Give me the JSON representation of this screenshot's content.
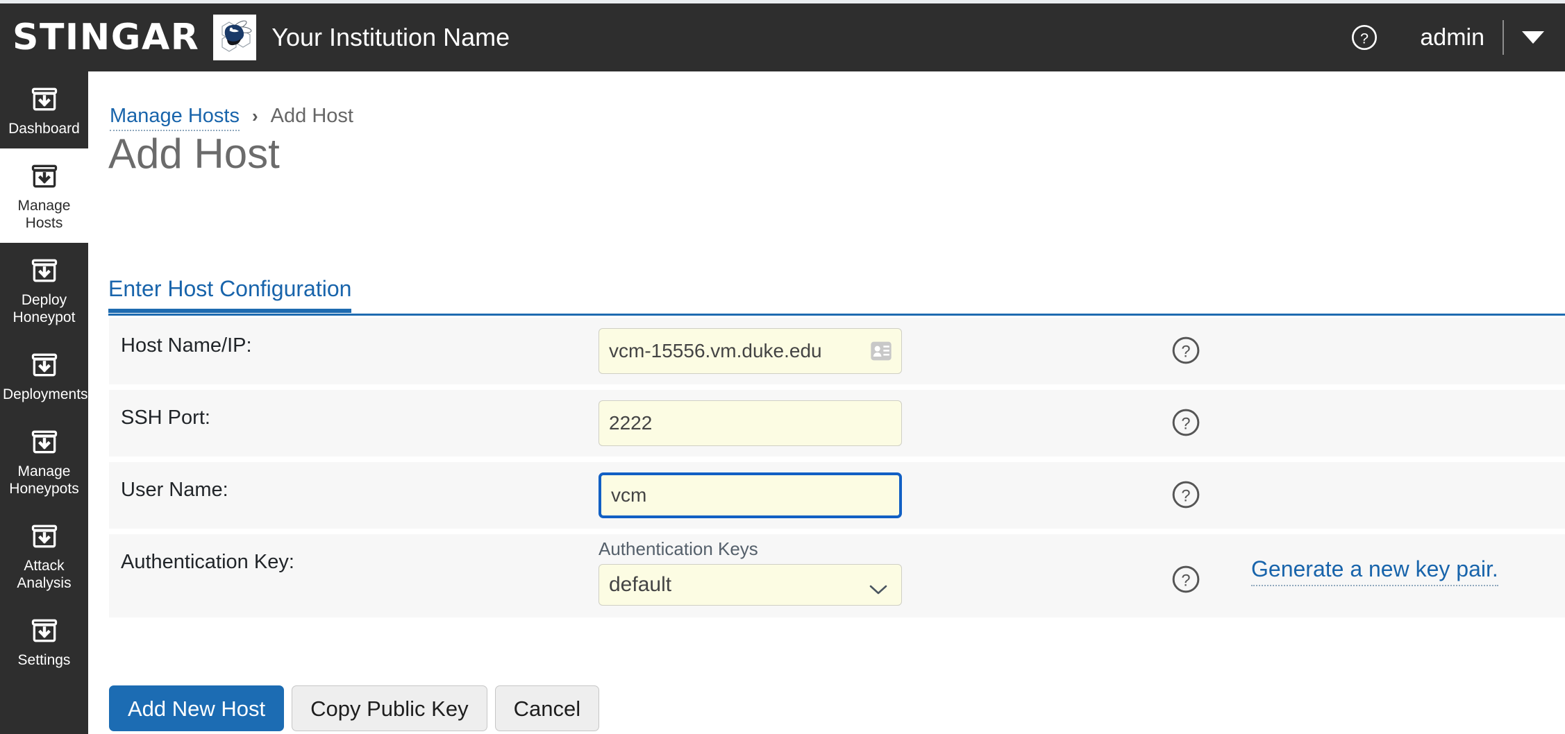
{
  "header": {
    "wordmark": "STINGAR",
    "logo_icon": "bee-honeycomb-logo",
    "institution": "Your Institution Name",
    "help_icon": "help-circle-icon",
    "username": "admin",
    "caret_icon": "caret-down-icon"
  },
  "sidebar": {
    "items": [
      {
        "label": "Dashboard",
        "icon": "archive-download-icon",
        "active": false
      },
      {
        "label": "Manage Hosts",
        "icon": "archive-download-icon",
        "active": true
      },
      {
        "label": "Deploy Honeypot",
        "icon": "archive-download-icon",
        "active": false
      },
      {
        "label": "Deployments",
        "icon": "archive-download-icon",
        "active": false
      },
      {
        "label": "Manage Honeypots",
        "icon": "archive-download-icon",
        "active": false
      },
      {
        "label": "Attack Analysis",
        "icon": "archive-download-icon",
        "active": false
      },
      {
        "label": "Settings",
        "icon": "archive-download-icon",
        "active": false
      }
    ]
  },
  "breadcrumb": {
    "parent": "Manage Hosts",
    "separator": "›",
    "current": "Add Host"
  },
  "page": {
    "title": "Add Host",
    "tab_label": "Enter Host Configuration"
  },
  "form": {
    "rows": [
      {
        "label": "Host Name/IP:",
        "value": "vcm-15556.vm.duke.edu",
        "icon": "contact-card-icon",
        "help_icon": "help-circle-icon"
      },
      {
        "label": "SSH Port:",
        "value": "2222",
        "help_icon": "help-circle-icon"
      },
      {
        "label": "User Name:",
        "value": "vcm",
        "help_icon": "help-circle-icon",
        "focused": true
      },
      {
        "label": "Authentication Key:",
        "select_label": "Authentication Keys",
        "selected": "default",
        "options": [
          "default"
        ],
        "chevron_icon": "chevron-down-icon",
        "help_icon": "help-circle-icon",
        "link": "Generate a new key pair."
      }
    ]
  },
  "buttons": {
    "primary": "Add New Host",
    "copy_key": "Copy Public Key",
    "cancel": "Cancel"
  },
  "colors": {
    "accent_blue": "#1864ab",
    "tab_underline": "#1e6bb0",
    "header_dark": "#2e2e2e",
    "row_bg": "#f7f7f7",
    "input_bg": "#fcfce3",
    "focus_border": "#1260c4"
  }
}
